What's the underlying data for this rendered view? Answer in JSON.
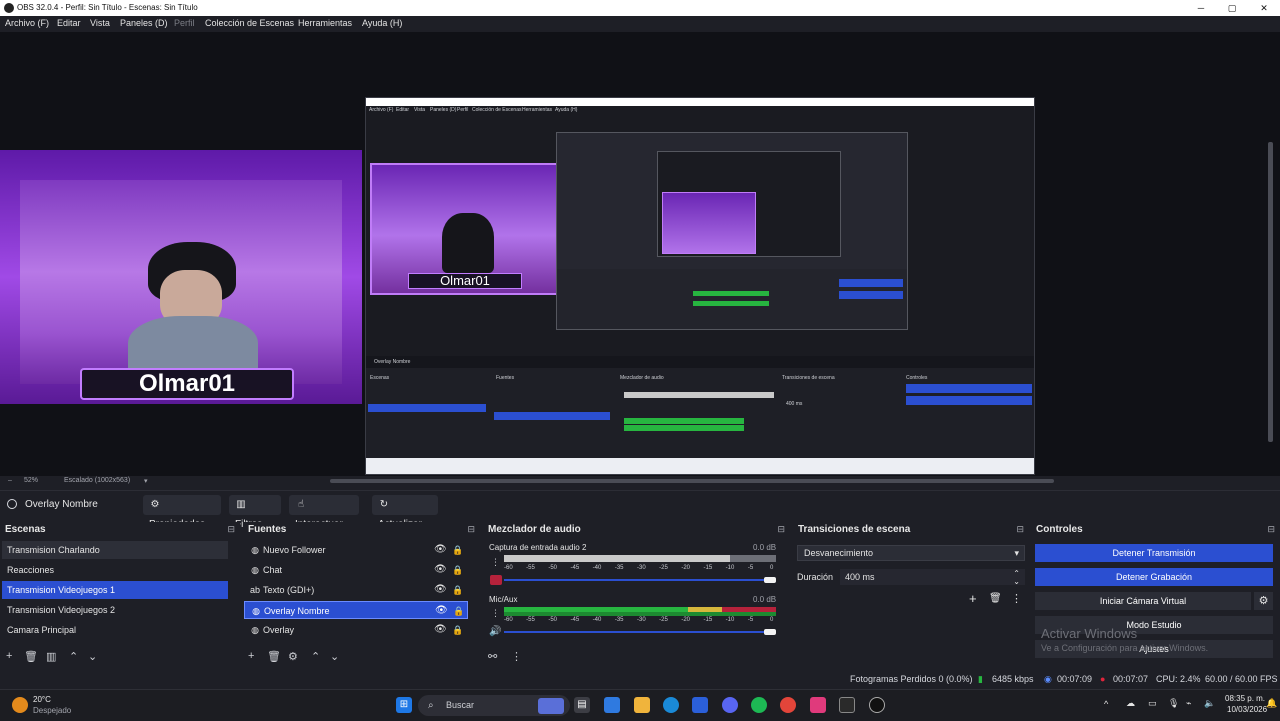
{
  "window": {
    "title": "OBS 32.0.4 - Perfil: Sin Título - Escenas: Sin Título",
    "minimize": "─",
    "maximize": "▢",
    "close": "✕"
  },
  "menu": [
    "Archivo (F)",
    "Editar",
    "Vista",
    "Paneles (D)",
    "Perfil",
    "Colección de Escenas",
    "Herramientas",
    "Ayuda (H)"
  ],
  "preview": {
    "name_overlay": "Olmar01",
    "nested_name_overlay": "Olmar01",
    "zoom": "52%",
    "scaled": "Escalado (1002x563)"
  },
  "source_toolbar": {
    "selected_source": "Overlay Nombre",
    "properties": "Propiedades",
    "filters": "Filtros",
    "interact": "Interactuar",
    "refresh": "Actualizar"
  },
  "scenes": {
    "title": "Escenas",
    "items": [
      "Transmision Charlando",
      "Reacciones",
      "Transmision Videojuegos 1",
      "Transmision Videojuegos 2",
      "Camara Principal"
    ],
    "selected_index": 2
  },
  "sources": {
    "title": "Fuentes",
    "items": [
      {
        "label": "Nuevo Follower",
        "icon": "globe-icon"
      },
      {
        "label": "Chat",
        "icon": "globe-icon"
      },
      {
        "label": "Texto (GDI+)",
        "icon": "text-icon"
      },
      {
        "label": "Overlay Nombre",
        "icon": "globe-icon"
      },
      {
        "label": "Overlay",
        "icon": "globe-icon"
      }
    ],
    "selected_index": 3
  },
  "mixer": {
    "title": "Mezclador de audio",
    "channels": [
      {
        "name": "Captura de entrada audio 2",
        "db": "0.0 dB",
        "level": 0.0,
        "muted": true
      },
      {
        "name": "Mic/Aux",
        "db": "0.0 dB",
        "level": 1.0,
        "muted": false
      }
    ],
    "ticks": [
      "-60",
      "-55",
      "-50",
      "-45",
      "-40",
      "-35",
      "-30",
      "-25",
      "-20",
      "-15",
      "-10",
      "-5",
      "0"
    ]
  },
  "transitions": {
    "title": "Transiciones de escena",
    "selected": "Desvanecimiento",
    "duration_label": "Duración",
    "duration_value": "400 ms"
  },
  "controls": {
    "title": "Controles",
    "stop_stream": "Detener Transmisión",
    "stop_record": "Detener Grabación",
    "virtual_cam": "Iniciar Cámara Virtual",
    "studio_mode": "Modo Estudio",
    "settings": "Ajustes"
  },
  "watermark": {
    "line1": "Activar Windows",
    "line2": "Ve a Configuración para activar Windows."
  },
  "status": {
    "dropped": "Fotogramas Perdidos 0 (0.0%)",
    "bitrate": "6485 kbps",
    "stream_time": "00:07:09",
    "rec_time": "00:07:07",
    "cpu": "CPU: 2.4%",
    "fps": "60.00 / 60.00 FPS"
  },
  "taskbar": {
    "weather_temp": "20°C",
    "weather_desc": "Despejado",
    "search": "Buscar",
    "time": "08:35 p. m.",
    "date": "10/03/2026"
  },
  "colors": {
    "accent": "#2b4fd1",
    "background": "#1e1f26",
    "meter_green": "#27b540",
    "meter_yellow": "#d6b73c",
    "meter_red": "#b5223b",
    "overlay_purple": "#b778e6"
  }
}
